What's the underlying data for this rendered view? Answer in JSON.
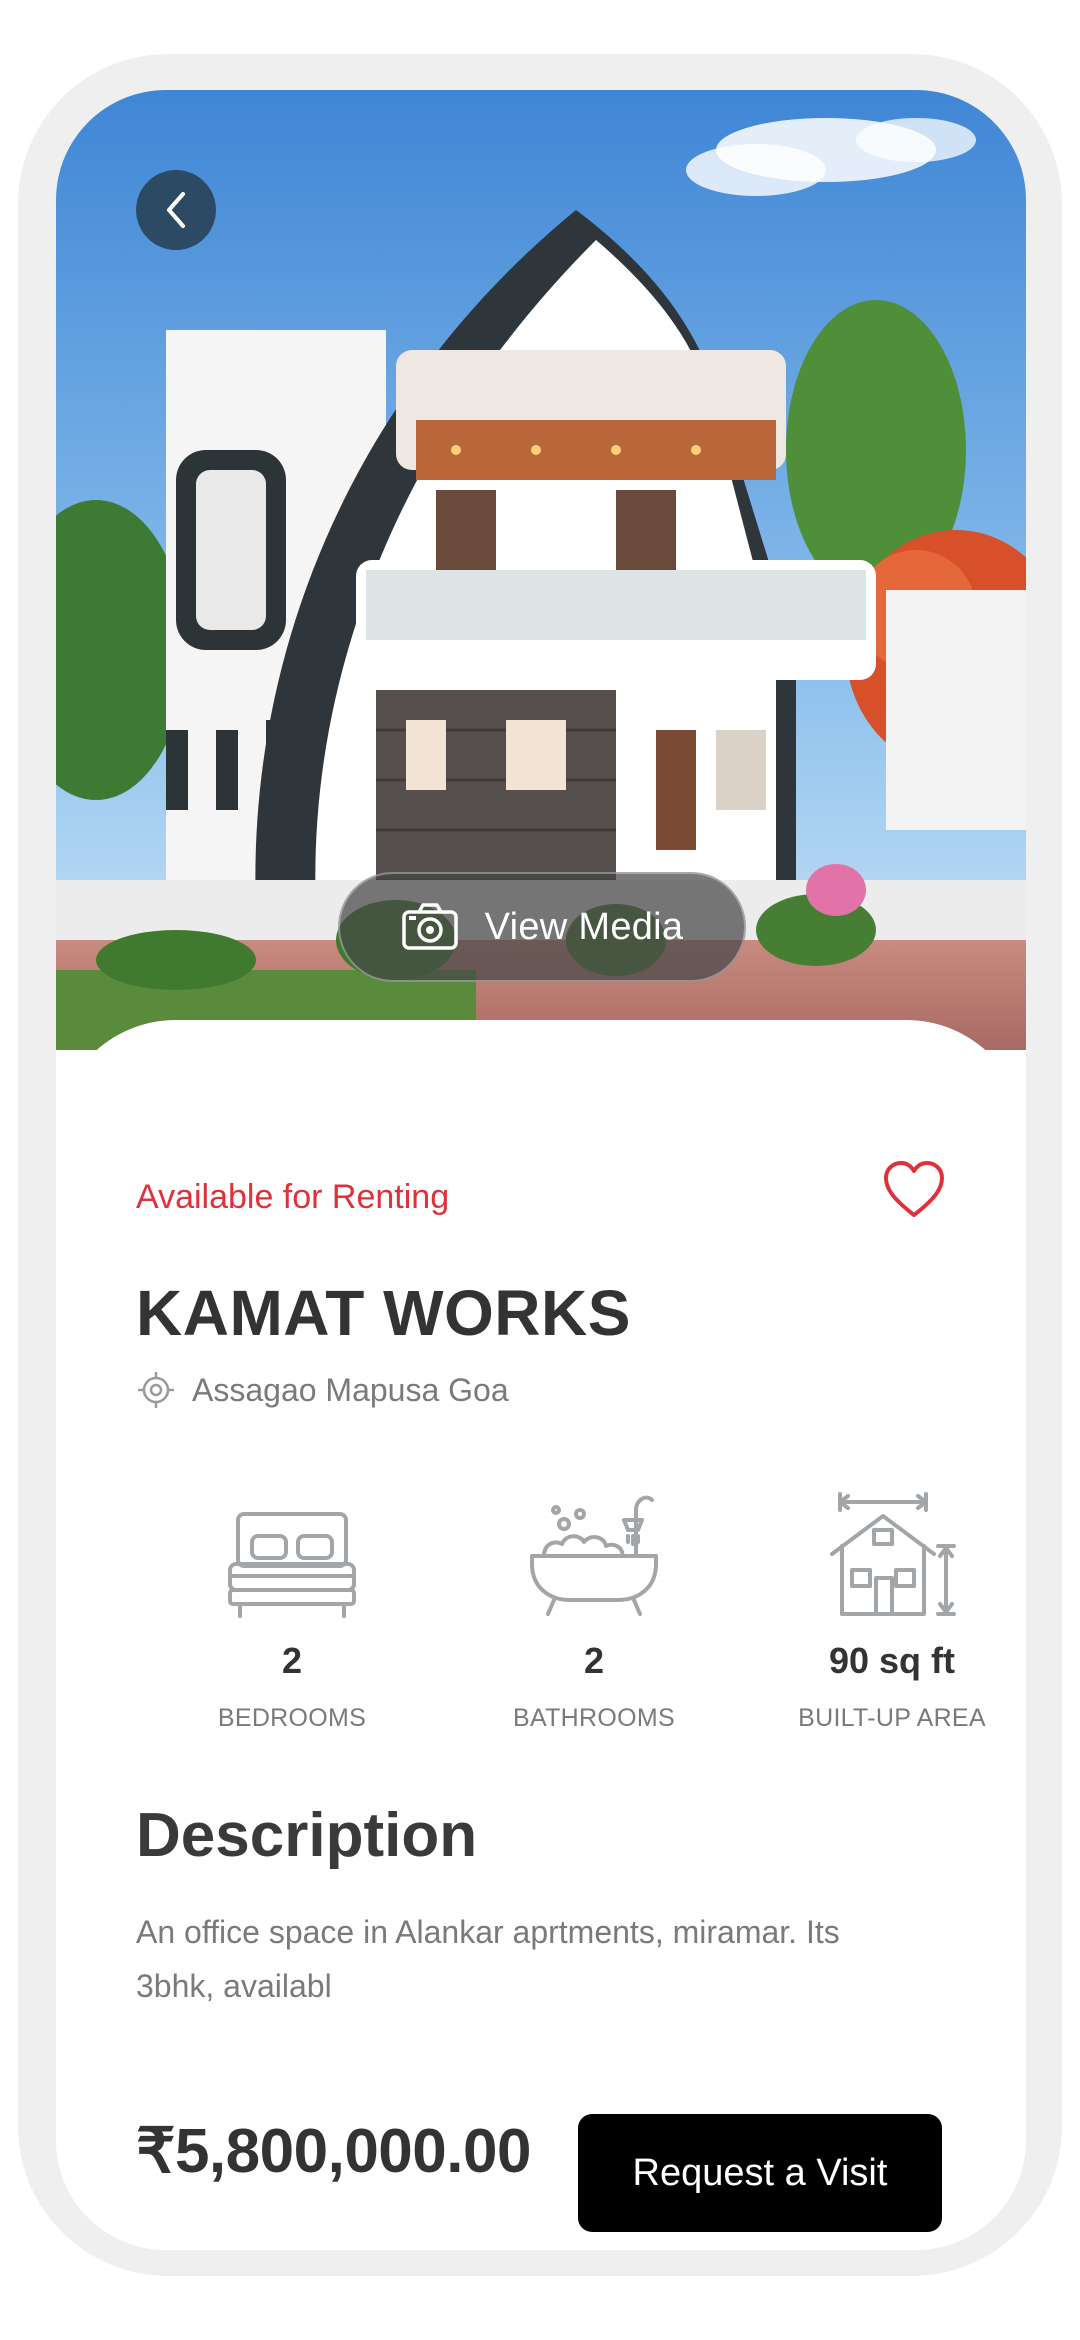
{
  "hero": {
    "view_media_label": "View Media",
    "icons": {
      "back": "chevron-left-icon",
      "camera": "camera-icon"
    }
  },
  "property": {
    "availability": "Available for Renting",
    "title": "KAMAT WORKS",
    "location": "Assagao Mapusa Goa",
    "favorite_icon": "heart-icon",
    "location_icon": "location-target-icon"
  },
  "features": [
    {
      "icon": "bed-icon",
      "value": "2",
      "label": "BEDROOMS"
    },
    {
      "icon": "bathtub-icon",
      "value": "2",
      "label": "BATHROOMS"
    },
    {
      "icon": "house-area-icon",
      "value": "90 sq ft",
      "label": "BUILT-UP AREA"
    }
  ],
  "description": {
    "heading": "Description",
    "text": "An office space in Alankar aprtments, miramar. Its 3bhk, availabl"
  },
  "footer": {
    "price": "₹5,800,000.00",
    "request_label": "Request a Visit"
  },
  "colors": {
    "accent_red": "#e0303a",
    "back_button": "#2c4a63",
    "primary_button": "#000000",
    "text_dark": "#333333",
    "text_muted": "#7a7a7a"
  }
}
